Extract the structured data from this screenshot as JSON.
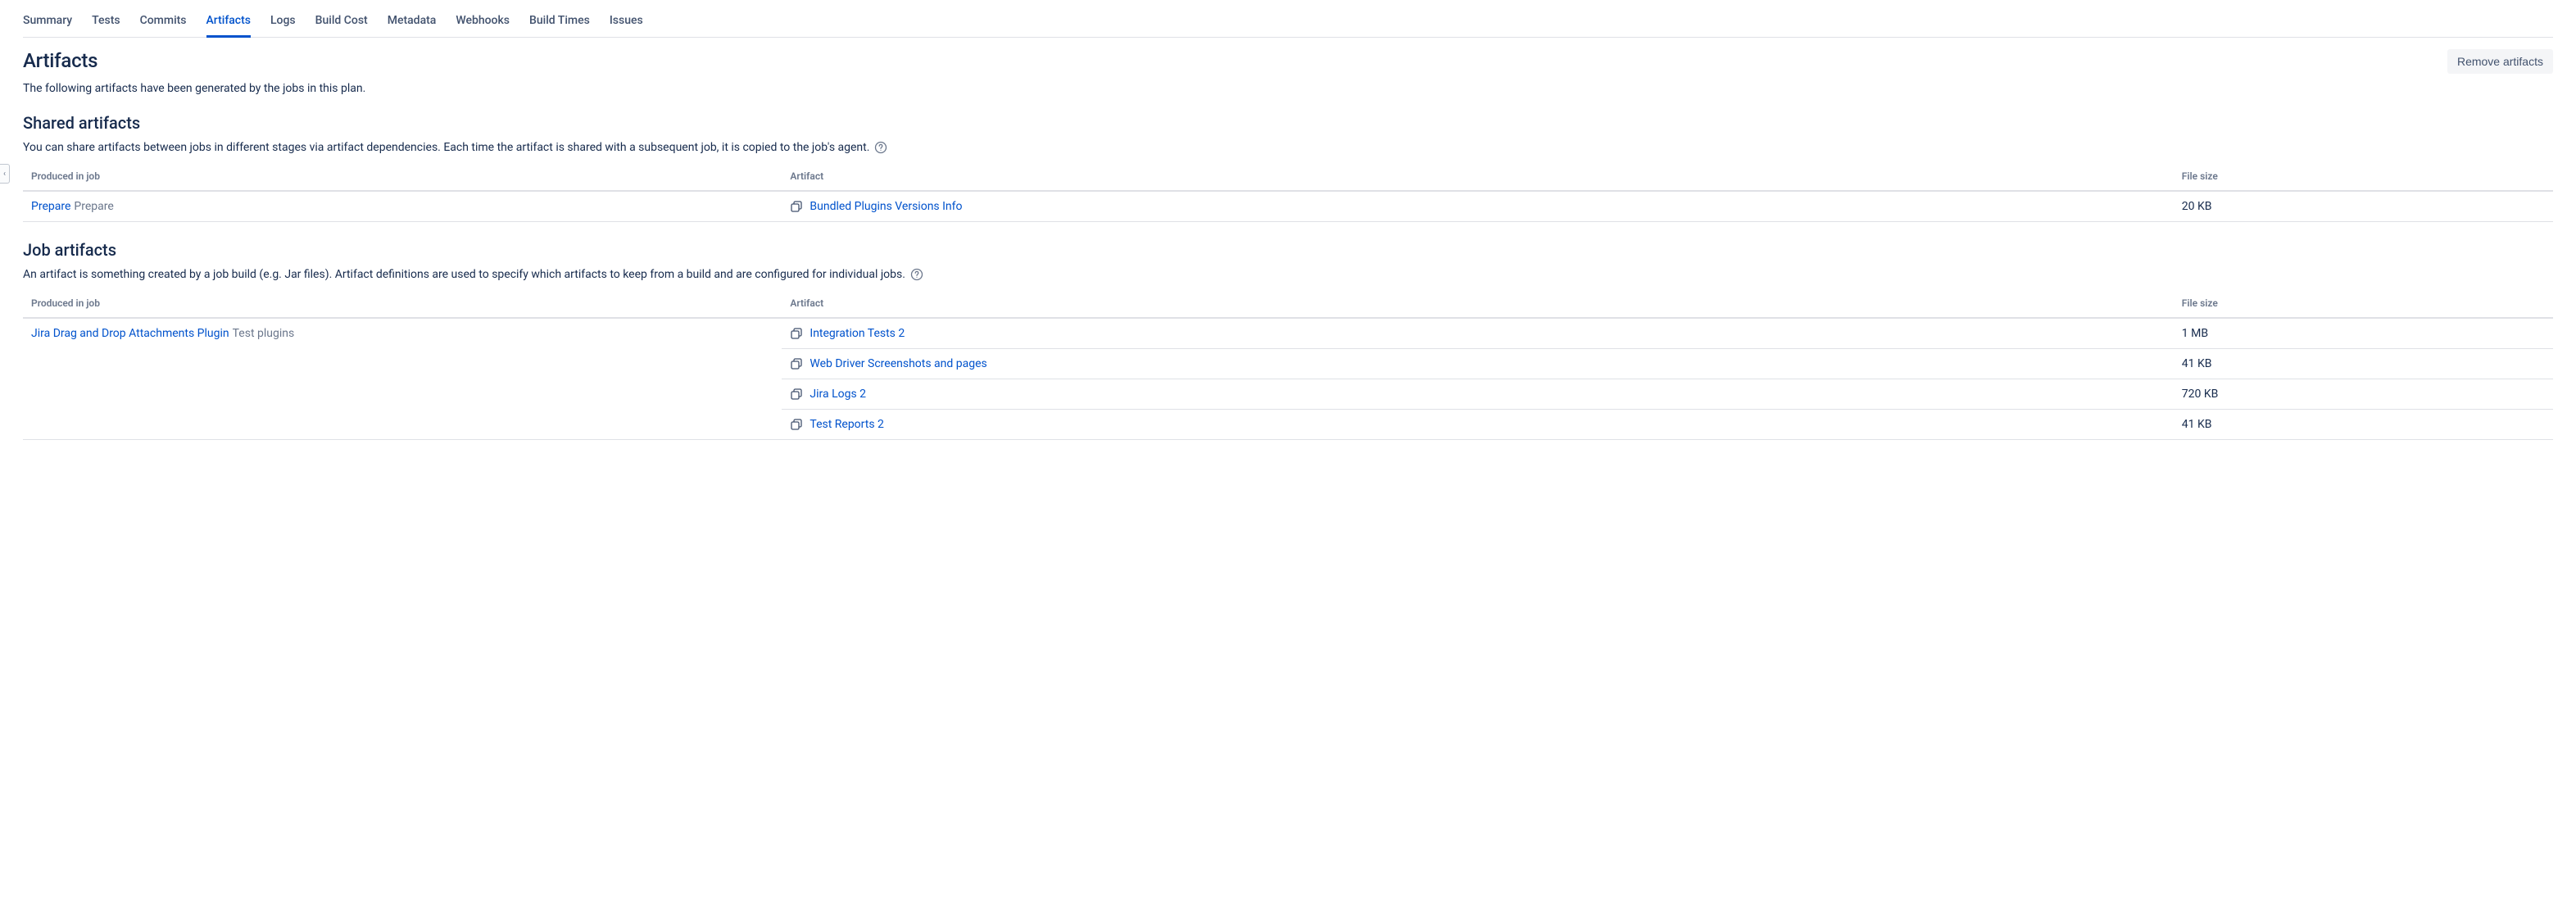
{
  "tabs": {
    "items": [
      {
        "label": "Summary",
        "active": false
      },
      {
        "label": "Tests",
        "active": false
      },
      {
        "label": "Commits",
        "active": false
      },
      {
        "label": "Artifacts",
        "active": true
      },
      {
        "label": "Logs",
        "active": false
      },
      {
        "label": "Build Cost",
        "active": false
      },
      {
        "label": "Metadata",
        "active": false
      },
      {
        "label": "Webhooks",
        "active": false
      },
      {
        "label": "Build Times",
        "active": false
      },
      {
        "label": "Issues",
        "active": false
      }
    ]
  },
  "page": {
    "title": "Artifacts",
    "remove_button": "Remove artifacts",
    "description": "The following artifacts have been generated by the jobs in this plan."
  },
  "shared": {
    "title": "Shared artifacts",
    "description": "You can share artifacts between jobs in different stages via artifact dependencies. Each time the artifact is shared with a subsequent job, it is copied to the job's agent.",
    "columns": {
      "job": "Produced in job",
      "artifact": "Artifact",
      "size": "File size"
    },
    "rows": [
      {
        "job_link": "Prepare",
        "job_stage": "Prepare",
        "artifact": "Bundled Plugins Versions Info",
        "size": "20 KB"
      }
    ]
  },
  "job": {
    "title": "Job artifacts",
    "description": "An artifact is something created by a job build (e.g. Jar files). Artifact definitions are used to specify which artifacts to keep from a build and are configured for individual jobs.",
    "columns": {
      "job": "Produced in job",
      "artifact": "Artifact",
      "size": "File size"
    },
    "groups": [
      {
        "job_link": "Jira Drag and Drop Attachments Plugin",
        "job_stage": "Test plugins",
        "artifacts": [
          {
            "name": "Integration Tests 2",
            "size": "1 MB"
          },
          {
            "name": "Web Driver Screenshots and pages",
            "size": "41 KB"
          },
          {
            "name": "Jira Logs 2",
            "size": "720 KB"
          },
          {
            "name": "Test Reports 2",
            "size": "41 KB"
          }
        ]
      }
    ]
  },
  "icons": {
    "help": "help-circle-icon",
    "share": "share-artifact-icon",
    "expand": "‹"
  }
}
